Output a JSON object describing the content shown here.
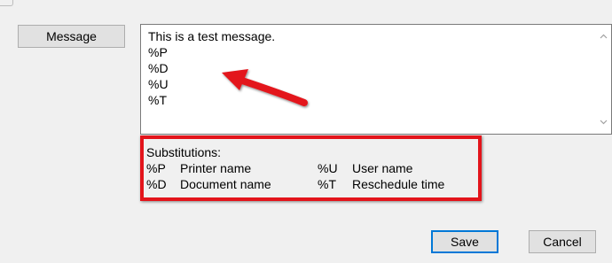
{
  "message_field": {
    "button_label": "Message",
    "lines": [
      "This is a test message.",
      "%P",
      "%D",
      "%U",
      "%T"
    ]
  },
  "substitutions": {
    "title": "Substitutions:",
    "rows": [
      {
        "code1": "%P",
        "desc1": "Printer name",
        "code2": "%U",
        "desc2": "User name"
      },
      {
        "code1": "%D",
        "desc1": "Document name",
        "code2": "%T",
        "desc2": "Reschedule time"
      }
    ]
  },
  "buttons": {
    "save_label": "Save",
    "cancel_label": "Cancel"
  },
  "icons": {
    "scroll_up": "chevron-up-icon",
    "scroll_down": "chevron-down-icon",
    "annotation_arrow": "red-arrow-icon"
  },
  "colors": {
    "annotation_red": "#e3141b",
    "focus_blue": "#0078d7",
    "window_bg": "#f0f0f0",
    "button_bg": "#e1e1e1"
  }
}
